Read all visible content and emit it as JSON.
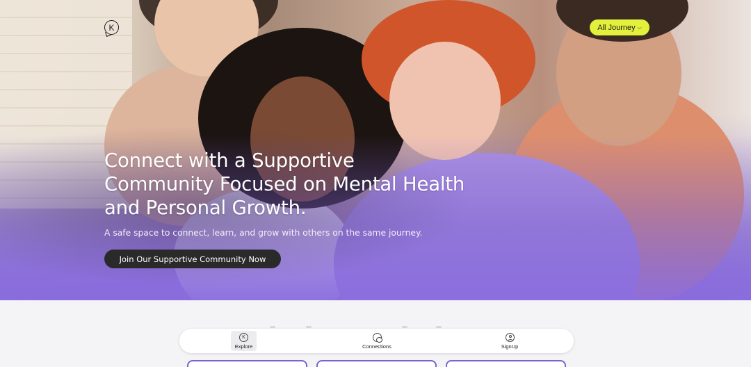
{
  "header": {
    "logo_letter": "K",
    "journey_button_label": "All Journey",
    "journey_button_color": "#e3f03c"
  },
  "hero": {
    "headline": "Connect with a Supportive Community Focused on Mental Health and Personal Growth.",
    "subline": "A safe space to connect, learn, and grow with others on the same journey.",
    "cta_label": "Join Our Supportive Community Now",
    "overlay_color": "#8a6cde"
  },
  "tabbar": {
    "tabs": [
      {
        "label": "Explore",
        "icon": "k-logo-icon",
        "active": true
      },
      {
        "label": "Connections",
        "icon": "chat-bubbles-icon",
        "active": false
      },
      {
        "label": "SignUp",
        "icon": "user-icon",
        "active": false
      }
    ]
  },
  "theme": {
    "accent": "#7b62cf",
    "cta_bg": "#2a2a2b"
  }
}
